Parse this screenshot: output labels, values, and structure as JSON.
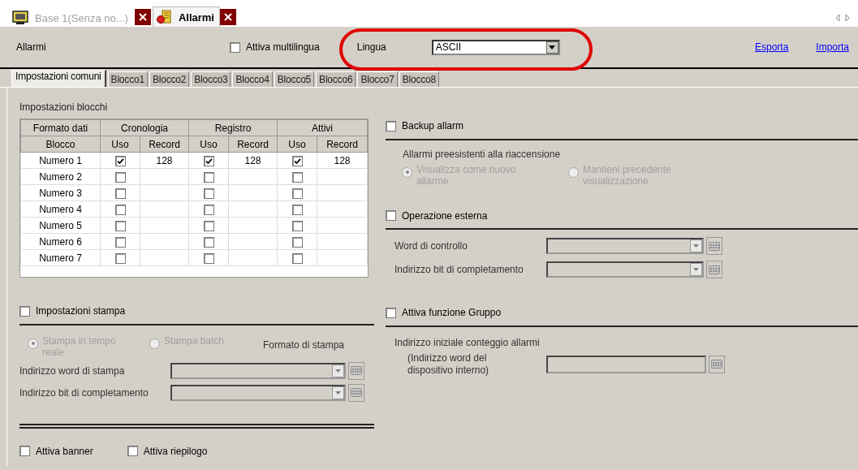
{
  "doc_tabs": [
    {
      "label": "Base 1(Senza no...)",
      "selected": false,
      "kind": "screen"
    },
    {
      "label": "Allarmi",
      "selected": true,
      "kind": "alarm"
    }
  ],
  "header": {
    "title": "Allarmi",
    "multilingual": {
      "label": "Attiva multilingua",
      "checked": false
    },
    "language": {
      "label": "Lingua",
      "value": "ASCII"
    },
    "links": [
      "Esporta",
      "Importa"
    ]
  },
  "tabs": [
    {
      "label": "Impostazioni comuni",
      "selected": true
    },
    {
      "label": "Blocco1",
      "selected": false
    },
    {
      "label": "Blocco2",
      "selected": false
    },
    {
      "label": "Blocco3",
      "selected": false
    },
    {
      "label": "Blocco4",
      "selected": false
    },
    {
      "label": "Blocco5",
      "selected": false
    },
    {
      "label": "Blocco6",
      "selected": false
    },
    {
      "label": "Blocco7",
      "selected": false
    },
    {
      "label": "Blocco8",
      "selected": false
    }
  ],
  "block_settings": {
    "title": "Impostazioni blocchi",
    "group_headers": [
      "Formato dati",
      "Cronologia",
      "Registro",
      "Attivi"
    ],
    "columns": [
      "Blocco",
      "Uso",
      "Record",
      "Uso",
      "Record",
      "Uso",
      "Record"
    ],
    "rows": [
      {
        "block": "Numero 1",
        "groups": [
          {
            "use": true,
            "record": "128"
          },
          {
            "use": true,
            "record": "128"
          },
          {
            "use": true,
            "record": "128"
          }
        ]
      },
      {
        "block": "Numero 2",
        "groups": [
          {
            "use": false
          },
          {
            "use": false
          },
          {
            "use": false
          }
        ]
      },
      {
        "block": "Numero 3",
        "groups": [
          {
            "use": false
          },
          {
            "use": false
          },
          {
            "use": false
          }
        ]
      },
      {
        "block": "Numero 4",
        "groups": [
          {
            "use": false
          },
          {
            "use": false
          },
          {
            "use": false
          }
        ]
      },
      {
        "block": "Numero 5",
        "groups": [
          {
            "use": false
          },
          {
            "use": false
          },
          {
            "use": false
          }
        ]
      },
      {
        "block": "Numero 6",
        "groups": [
          {
            "use": false
          },
          {
            "use": false
          },
          {
            "use": false
          }
        ]
      },
      {
        "block": "Numero 7",
        "groups": [
          {
            "use": false
          },
          {
            "use": false
          },
          {
            "use": false
          }
        ]
      }
    ]
  },
  "print": {
    "label": "Impostazioni stampa",
    "checked": false,
    "disabled": true,
    "modes": [
      {
        "label": "Stampa in tempo reale",
        "selected": true
      },
      {
        "label": "Stampa batch",
        "selected": false
      }
    ],
    "format_label": "Formato di stampa",
    "fields": [
      {
        "label": "Indirizzo word di stampa"
      },
      {
        "label": "Indirizzo bit di completamento"
      }
    ]
  },
  "footer": [
    {
      "label": "Attiva banner",
      "checked": false
    },
    {
      "label": "Attiva riepilogo",
      "checked": false
    }
  ],
  "backup": {
    "label": "Backup allarm",
    "checked": false,
    "disabled": true,
    "caption": "Allarmi preesistenti alla riaccensione",
    "options": [
      {
        "label": "Visualizza come nuovo allarme",
        "selected": true
      },
      {
        "label": "Mantieni precedente visualizzazione",
        "selected": false
      }
    ]
  },
  "external": {
    "label": "Operazione esterna",
    "checked": false,
    "fields": [
      {
        "label": "Word di controllo"
      },
      {
        "label": "Indirizzo bit di completamento"
      }
    ]
  },
  "group": {
    "label": "Attiva funzione Gruppo",
    "checked": false,
    "caption": "Indirizzo iniziale conteggio allarmi",
    "field_label": "(Indirizzo word del dispositivo interno)"
  }
}
